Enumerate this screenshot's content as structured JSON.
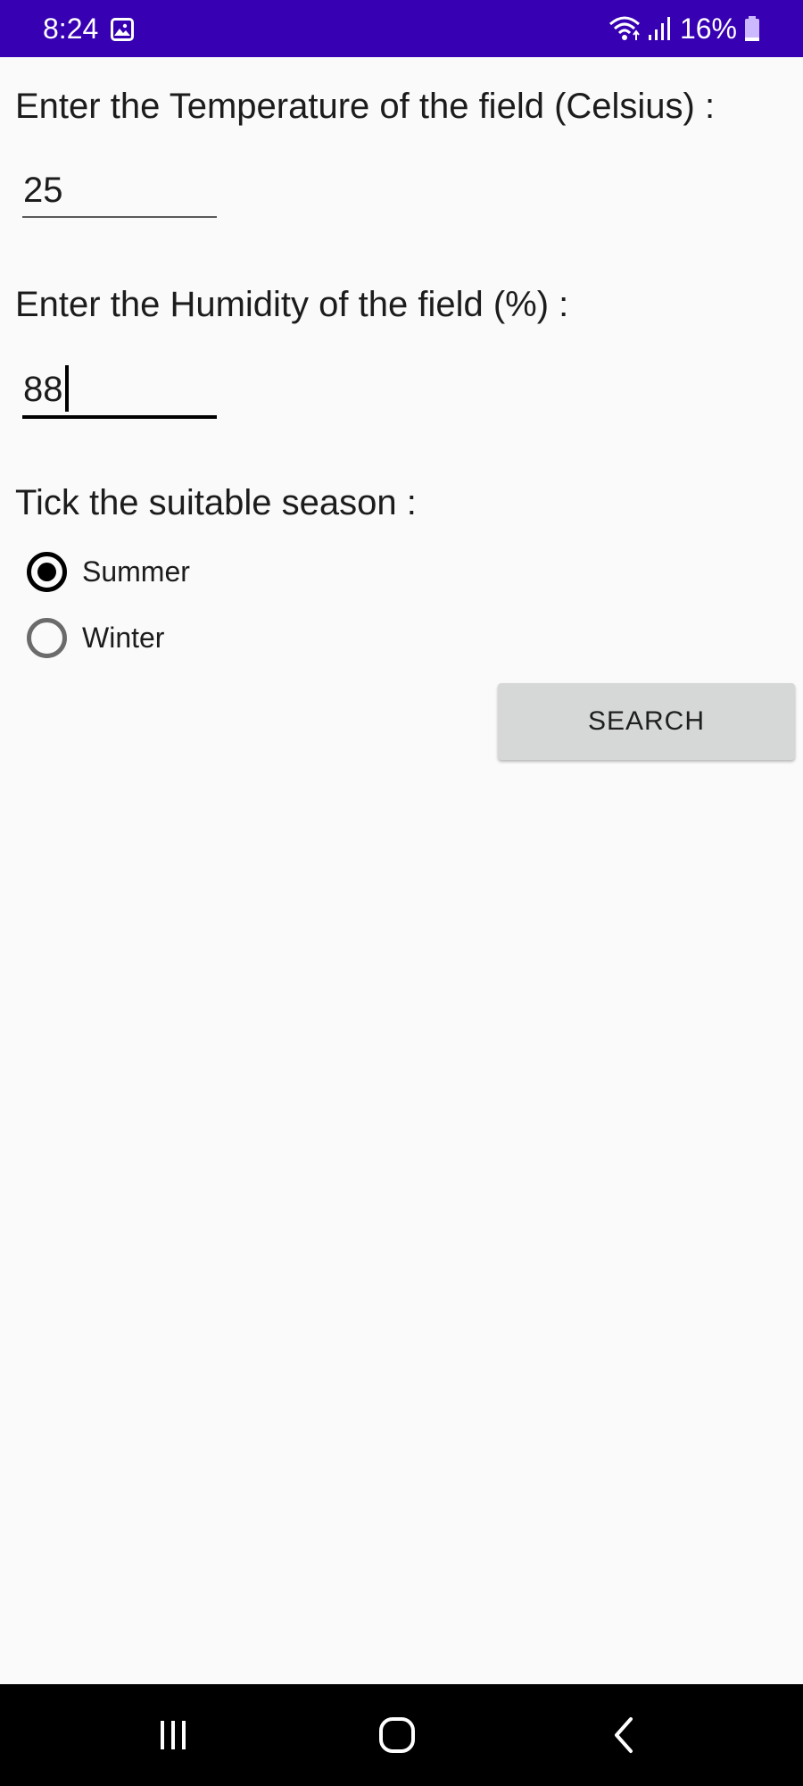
{
  "status_bar": {
    "time": "8:24",
    "battery_percent": "16%",
    "icons": [
      "image-notification-icon",
      "wifi-icon",
      "signal-icon",
      "battery-icon"
    ],
    "background_color": "#3700b3"
  },
  "form": {
    "temperature": {
      "label": "Enter the Temperature of the field (Celsius) :",
      "value": "25"
    },
    "humidity": {
      "label": "Enter the Humidity of the field (%) :",
      "value": "88",
      "focused": true
    },
    "season": {
      "label": "Tick the suitable season :",
      "options": [
        {
          "label": "Summer",
          "checked": true
        },
        {
          "label": "Winter",
          "checked": false
        }
      ]
    },
    "search_button_label": "SEARCH"
  },
  "nav_bar": {
    "buttons": [
      "recent-apps-icon",
      "home-icon",
      "back-icon"
    ]
  }
}
